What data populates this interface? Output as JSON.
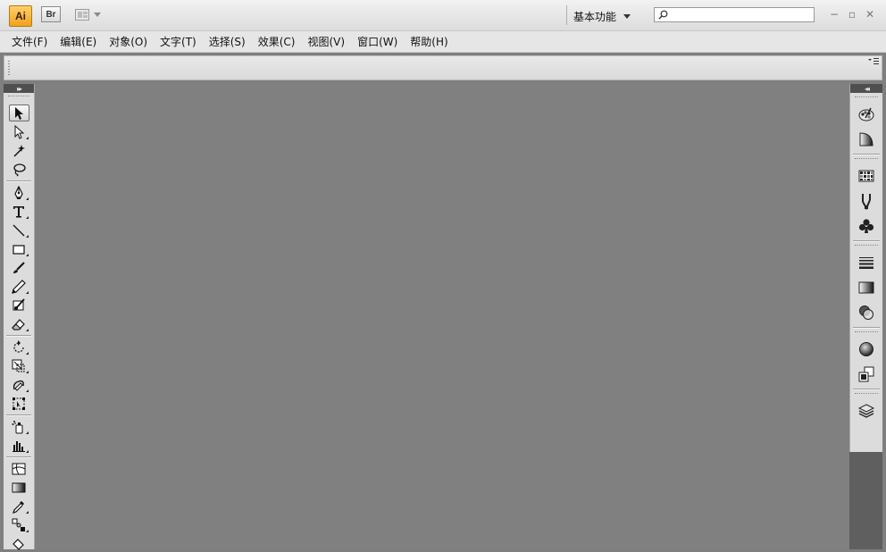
{
  "titlebar": {
    "app_logo": "Ai",
    "bridge_label": "Br",
    "workspace_label": "基本功能",
    "search": {
      "value": "",
      "placeholder": ""
    },
    "minimize": "−",
    "restore": "▫",
    "close": "✕"
  },
  "menu": [
    {
      "label": "文件(F)"
    },
    {
      "label": "编辑(E)"
    },
    {
      "label": "对象(O)"
    },
    {
      "label": "文字(T)"
    },
    {
      "label": "选择(S)"
    },
    {
      "label": "效果(C)"
    },
    {
      "label": "视图(V)"
    },
    {
      "label": "窗口(W)"
    },
    {
      "label": "帮助(H)"
    }
  ],
  "toolbox": {
    "collapse_glyph": "▸▸",
    "tools": [
      "selection-tool",
      "direct-selection-tool",
      "magic-wand-tool",
      "lasso-tool",
      "pen-tool",
      "type-tool",
      "line-segment-tool",
      "rectangle-tool",
      "paintbrush-tool",
      "pencil-tool",
      "blob-brush-tool",
      "eraser-tool",
      "rotate-tool",
      "scale-tool",
      "warp-tool",
      "free-transform-tool",
      "symbol-sprayer-tool",
      "column-graph-tool",
      "mesh-tool",
      "gradient-tool",
      "eyedropper-tool",
      "blend-tool",
      "live-paint-bucket-tool"
    ]
  },
  "dock": {
    "collapse_glyph": "◂◂",
    "panels": [
      "color-panel",
      "color-guide-panel",
      "swatches-panel",
      "brushes-panel",
      "symbols-panel",
      "stroke-panel",
      "gradient-panel",
      "transparency-panel",
      "appearance-panel",
      "graphic-styles-panel",
      "layers-panel"
    ]
  },
  "colors": {
    "canvas": "#808080",
    "chrome": "#dcdcdc",
    "app_logo_bg": "#f0a21c"
  }
}
